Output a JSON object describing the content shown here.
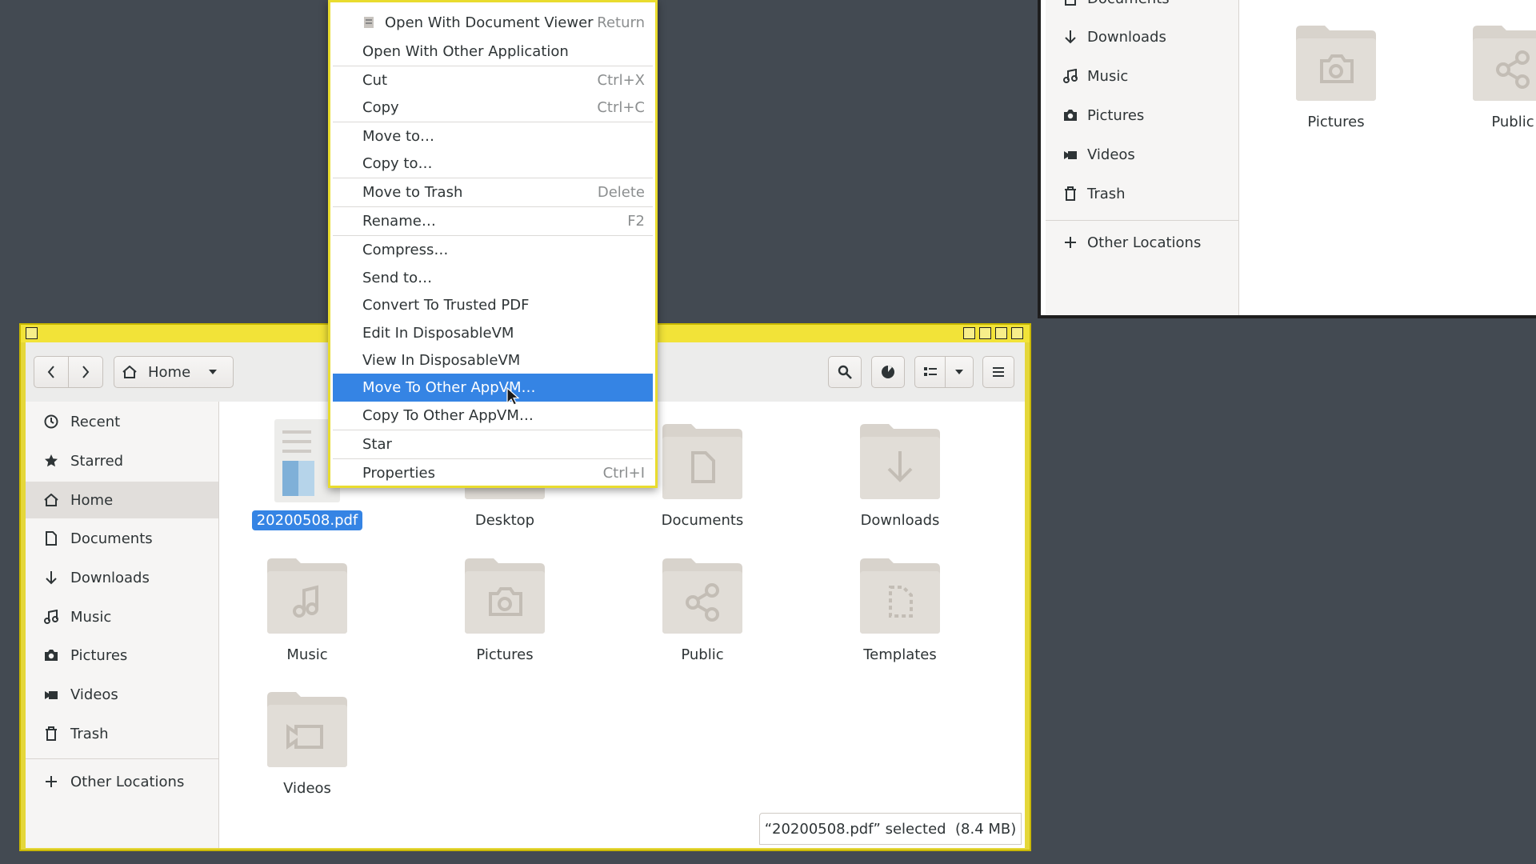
{
  "background_window": {
    "sidebar_items": [
      {
        "label": "Documents",
        "icon": "document-icon"
      },
      {
        "label": "Downloads",
        "icon": "download-arrow-icon"
      },
      {
        "label": "Music",
        "icon": "music-note-icon"
      },
      {
        "label": "Pictures",
        "icon": "camera-icon"
      },
      {
        "label": "Videos",
        "icon": "video-icon"
      },
      {
        "label": "Trash",
        "icon": "trash-icon"
      }
    ],
    "other_locations": "Other Locations",
    "folders": [
      {
        "label": "Pictures",
        "icon": "camera-icon"
      },
      {
        "label": "Public",
        "icon": "share-icon"
      }
    ]
  },
  "main_window": {
    "location": "Home",
    "sidebar_items": [
      {
        "label": "Recent",
        "icon": "clock-icon"
      },
      {
        "label": "Starred",
        "icon": "star-icon"
      },
      {
        "label": "Home",
        "icon": "home-icon",
        "active": true
      },
      {
        "label": "Documents",
        "icon": "document-icon"
      },
      {
        "label": "Downloads",
        "icon": "download-arrow-icon"
      },
      {
        "label": "Music",
        "icon": "music-note-icon"
      },
      {
        "label": "Pictures",
        "icon": "camera-icon"
      },
      {
        "label": "Videos",
        "icon": "video-icon"
      },
      {
        "label": "Trash",
        "icon": "trash-icon"
      }
    ],
    "other_locations": "Other Locations",
    "files": [
      {
        "label": "20200508.pdf",
        "icon": "pdf-file-icon",
        "selected": true
      },
      {
        "label": "Desktop",
        "icon": "folder-icon"
      },
      {
        "label": "Documents",
        "icon": "document-icon"
      },
      {
        "label": "Downloads",
        "icon": "download-arrow-icon"
      },
      {
        "label": "Music",
        "icon": "music-note-icon"
      },
      {
        "label": "Pictures",
        "icon": "camera-icon"
      },
      {
        "label": "Public",
        "icon": "share-icon"
      },
      {
        "label": "Templates",
        "icon": "template-icon"
      },
      {
        "label": "Videos",
        "icon": "video-icon"
      }
    ],
    "status": "“20200508.pdf” selected  (8.4 MB)"
  },
  "context_menu": {
    "items": [
      {
        "label": "Open With Document Viewer",
        "accel": "Return",
        "icon": "document-viewer-icon"
      },
      {
        "label": "Open With Other Application",
        "accel": ""
      },
      {
        "label": "Cut",
        "accel": "Ctrl+X"
      },
      {
        "label": "Copy",
        "accel": "Ctrl+C"
      },
      {
        "label": "Move to…",
        "accel": ""
      },
      {
        "label": "Copy to…",
        "accel": ""
      },
      {
        "label": "Move to Trash",
        "accel": "Delete"
      },
      {
        "label": "Rename…",
        "accel": "F2"
      },
      {
        "label": "Compress…",
        "accel": ""
      },
      {
        "label": "Send to…",
        "accel": ""
      },
      {
        "label": "Convert To Trusted PDF",
        "accel": ""
      },
      {
        "label": "Edit In DisposableVM",
        "accel": ""
      },
      {
        "label": "View In DisposableVM",
        "accel": ""
      },
      {
        "label": "Move To Other AppVM…",
        "accel": "",
        "highlighted": true
      },
      {
        "label": "Copy To Other AppVM…",
        "accel": ""
      },
      {
        "label": "Star",
        "accel": ""
      },
      {
        "label": "Properties",
        "accel": "Ctrl+I"
      }
    ]
  },
  "colors": {
    "accent": "#3584e4",
    "frame_yellow": "#e5d73a",
    "folder": "#d8d3cc",
    "desktop_bg": "#434a52"
  }
}
